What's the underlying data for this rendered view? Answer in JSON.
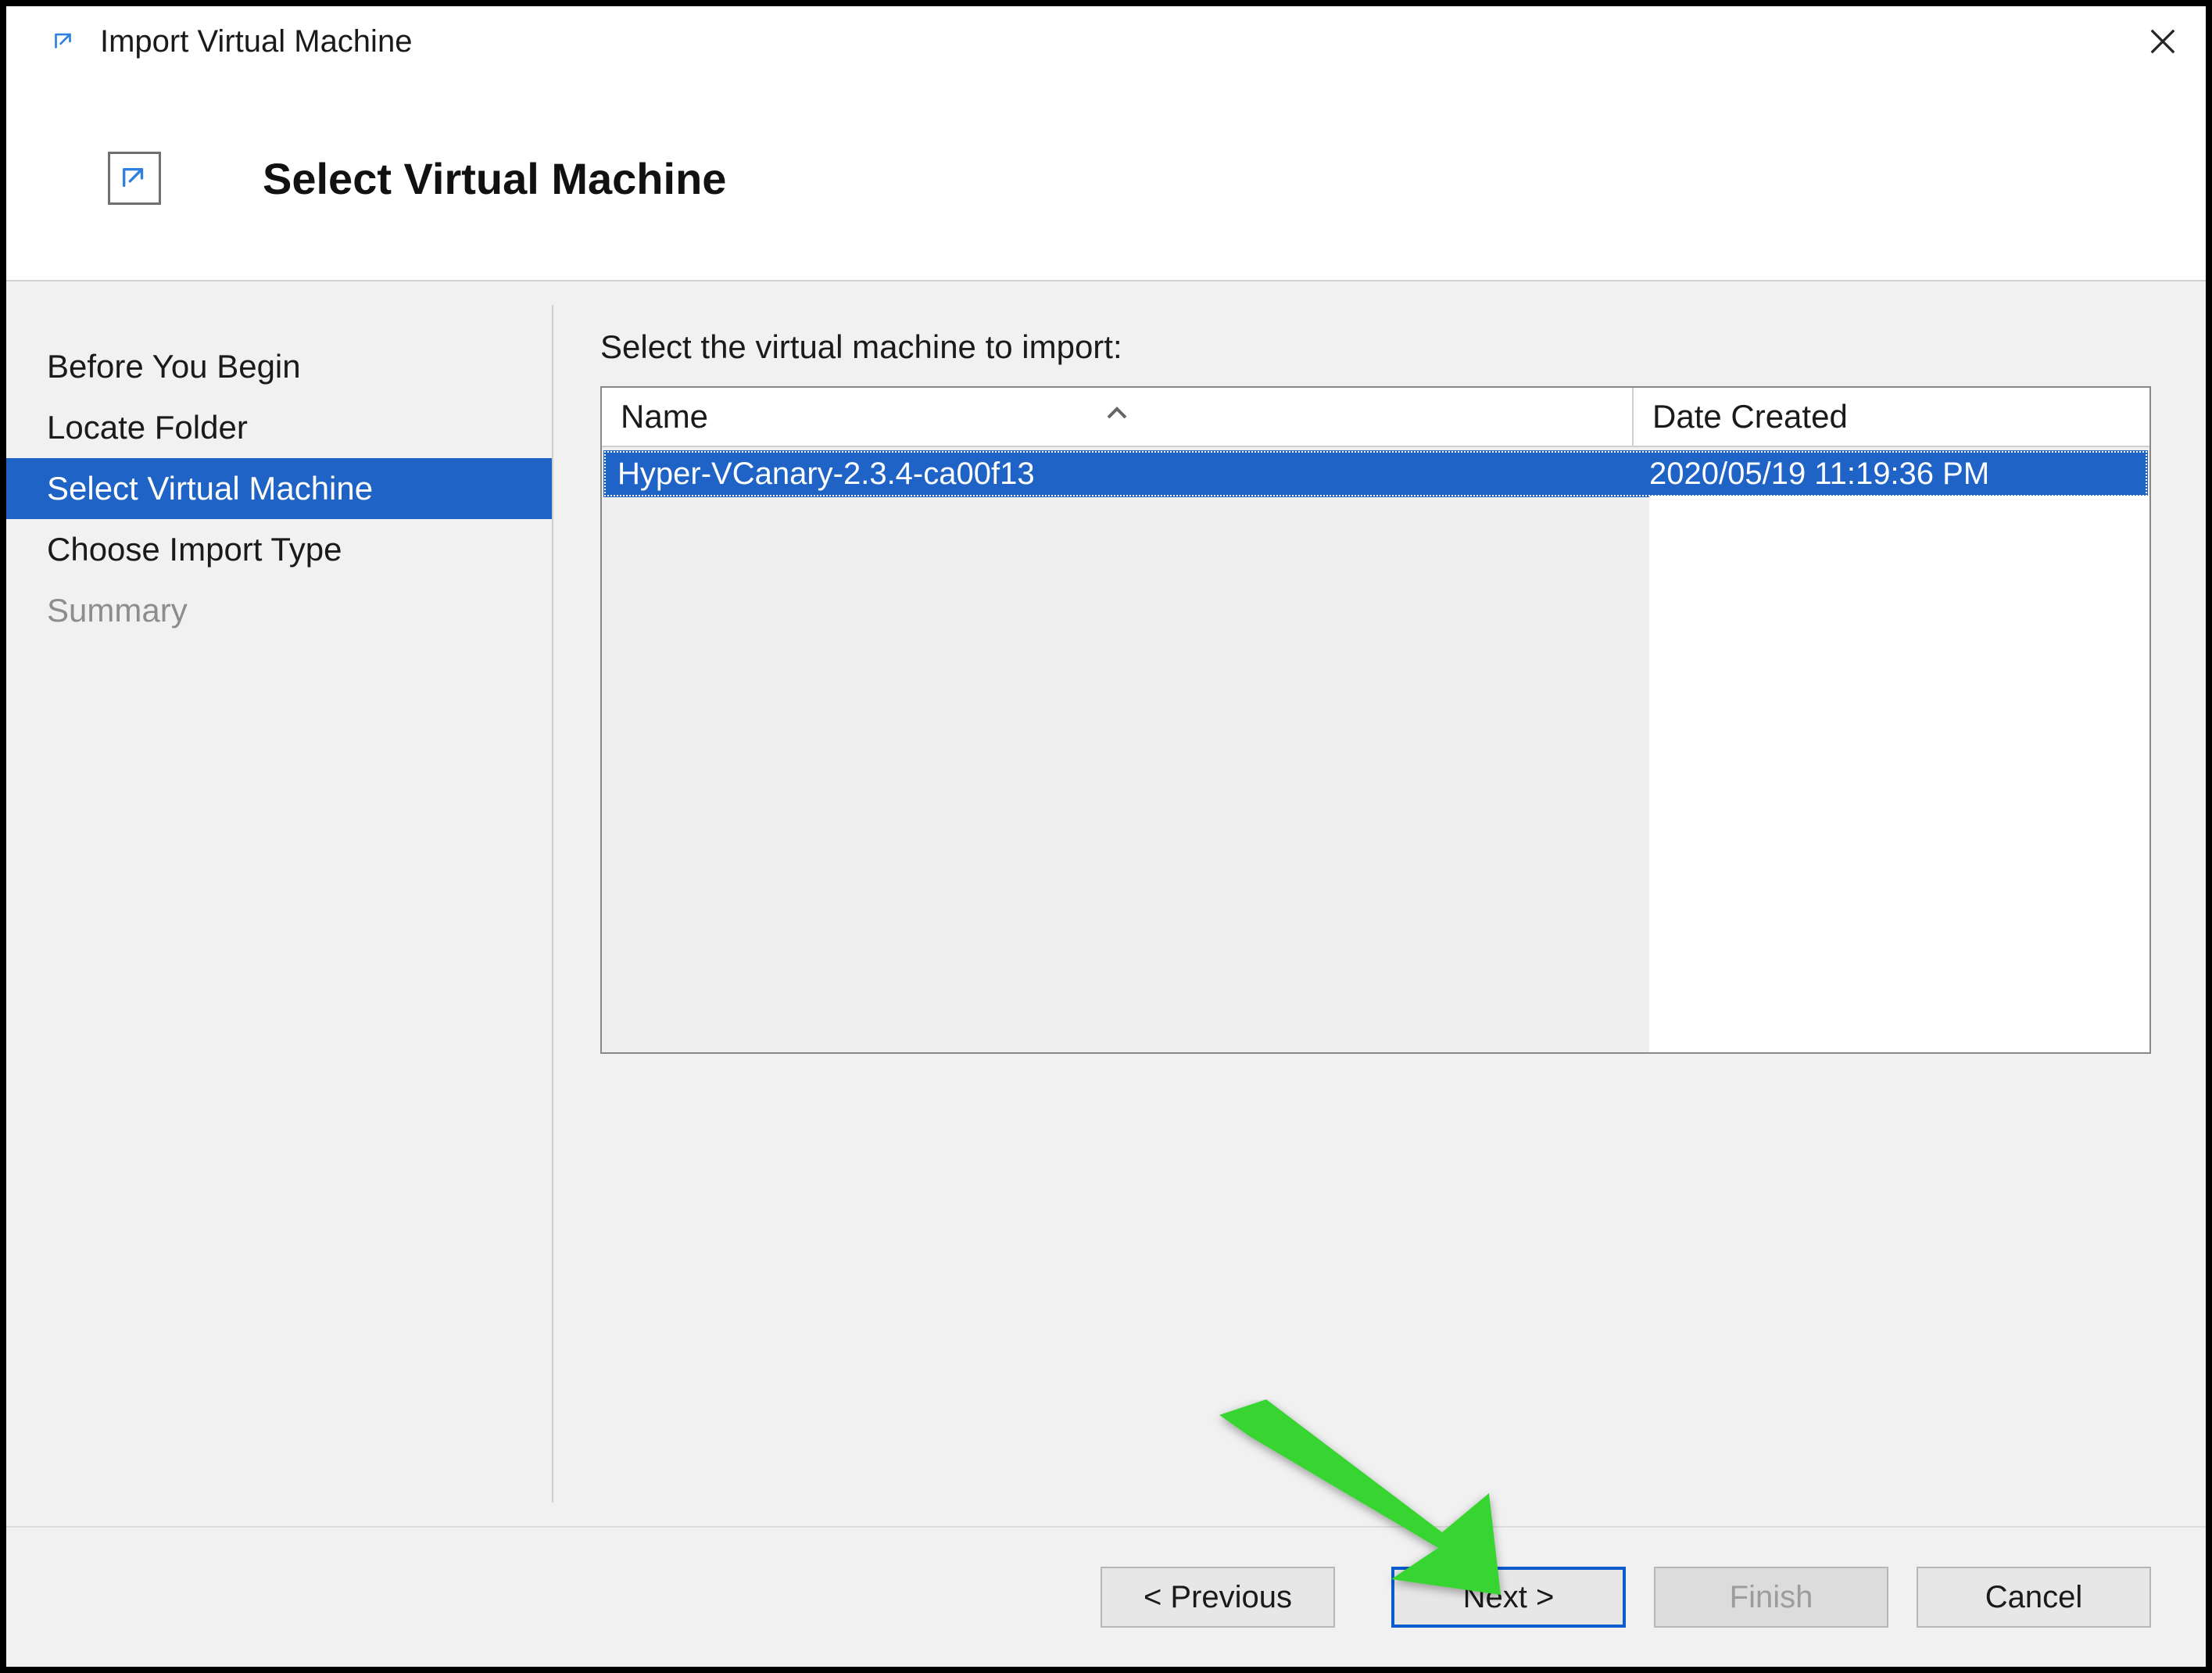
{
  "window": {
    "title": "Import Virtual Machine"
  },
  "page": {
    "heading": "Select Virtual Machine"
  },
  "sidebar": {
    "steps": [
      {
        "label": "Before You Begin",
        "state": "normal"
      },
      {
        "label": "Locate Folder",
        "state": "normal"
      },
      {
        "label": "Select Virtual Machine",
        "state": "active"
      },
      {
        "label": "Choose Import Type",
        "state": "normal"
      },
      {
        "label": "Summary",
        "state": "disabled"
      }
    ]
  },
  "content": {
    "instruction": "Select the virtual machine to import:",
    "list": {
      "columns": {
        "name": "Name",
        "date_created": "Date Created"
      },
      "sort_column": "name",
      "rows": [
        {
          "name": "Hyper-VCanary-2.3.4-ca00f13",
          "date_created": "2020/05/19 11:19:36 PM",
          "selected": true
        }
      ]
    }
  },
  "footer": {
    "previous": "< Previous",
    "next": "Next >",
    "finish": "Finish",
    "cancel": "Cancel",
    "default_button": "next",
    "disabled_buttons": [
      "finish"
    ]
  },
  "annotation": {
    "type": "arrow",
    "target_button": "next",
    "color": "#38d430"
  }
}
